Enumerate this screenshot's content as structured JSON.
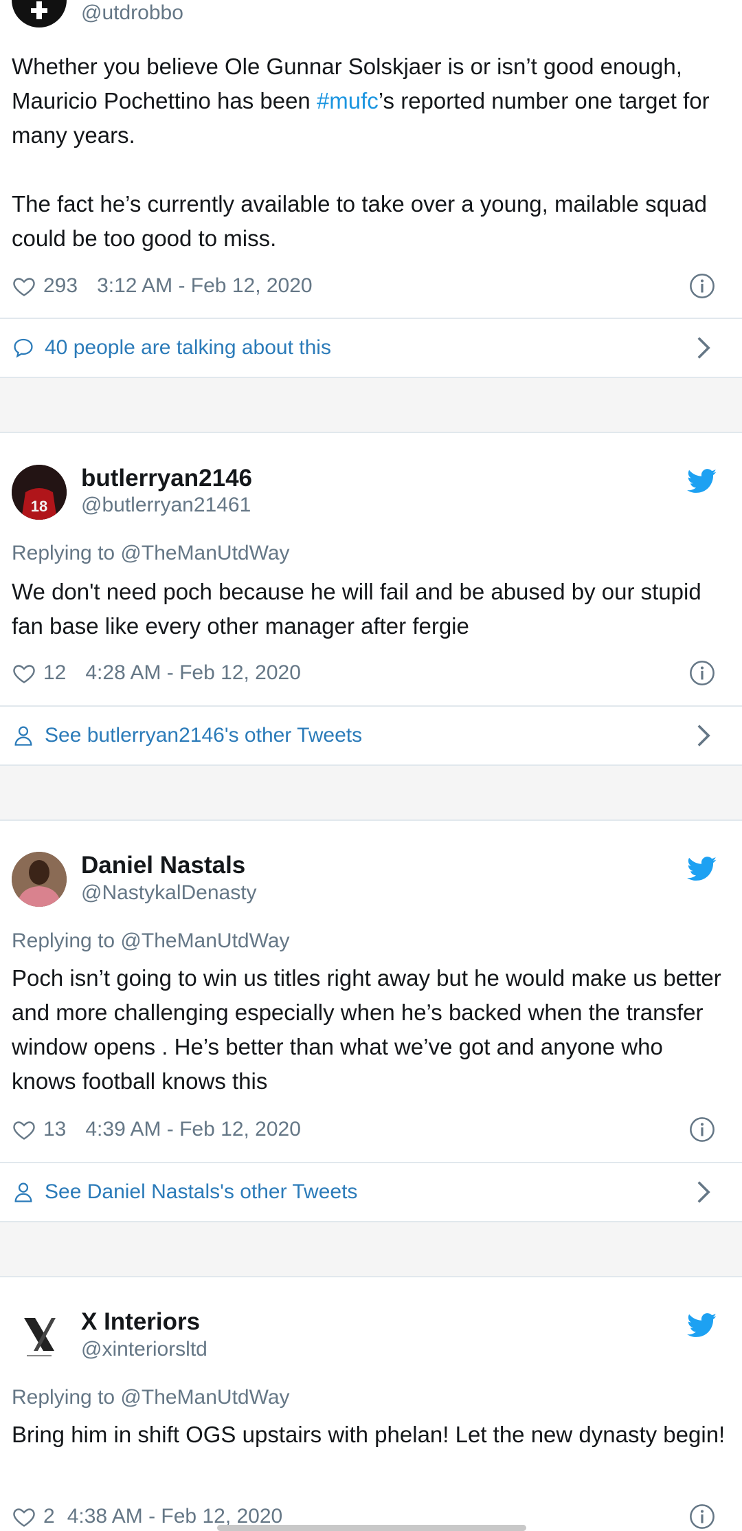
{
  "tweet1": {
    "handle": "@utdrobbo",
    "text_pre": "Whether you believe Ole Gunnar Solskjaer is or isn’t good enough, Mauricio Pochettino has been ",
    "hashtag": "#mufc",
    "text_post": "’s reported number one target for many years.",
    "text2": "The fact he’s currently available to take over a young, mailable squad could be too good to miss.",
    "likes": "293",
    "timestamp": "3:12 AM - Feb 12, 2020",
    "action_label": "40 people are talking about this"
  },
  "tweet2": {
    "name": "butlerryan2146",
    "handle": "@butlerryan21461",
    "replying": "Replying to @TheManUtdWay",
    "text": "We don't need poch because he will fail and be abused by our stupid fan base like every other manager after fergie",
    "likes": "12",
    "timestamp": "4:28 AM - Feb 12, 2020",
    "action_label": "See butlerryan2146's other Tweets"
  },
  "tweet3": {
    "name": "Daniel Nastals",
    "handle": "@NastykalDenasty",
    "replying": "Replying to @TheManUtdWay",
    "text": "Poch isn’t going to win us titles right away but he would make us better and more challenging especially when he’s backed when the transfer window opens . He’s better than what we’ve got and anyone who knows football knows this",
    "likes": "13",
    "timestamp": "4:39 AM - Feb 12, 2020",
    "action_label": "See Daniel Nastals's other Tweets"
  },
  "tweet4": {
    "name": "X Interiors",
    "handle": "@xinteriorsltd",
    "replying": "Replying to @TheManUtdWay",
    "text": "Bring him in shift OGS upstairs with phelan! Let the new dynasty begin!",
    "likes": "2",
    "timestamp": "4:38 AM - Feb 12, 2020"
  },
  "icons": {
    "like": "heart-outline-icon",
    "info": "info-circle-icon",
    "twitter": "twitter-bird-icon",
    "comment": "speech-bubble-icon",
    "profile": "person-outline-icon",
    "chevron": "chevron-right-icon"
  },
  "colors": {
    "link": "#2b7bb9",
    "hashtag": "#1b95e0",
    "twitter_blue": "#1da1f2",
    "muted": "#657786"
  }
}
